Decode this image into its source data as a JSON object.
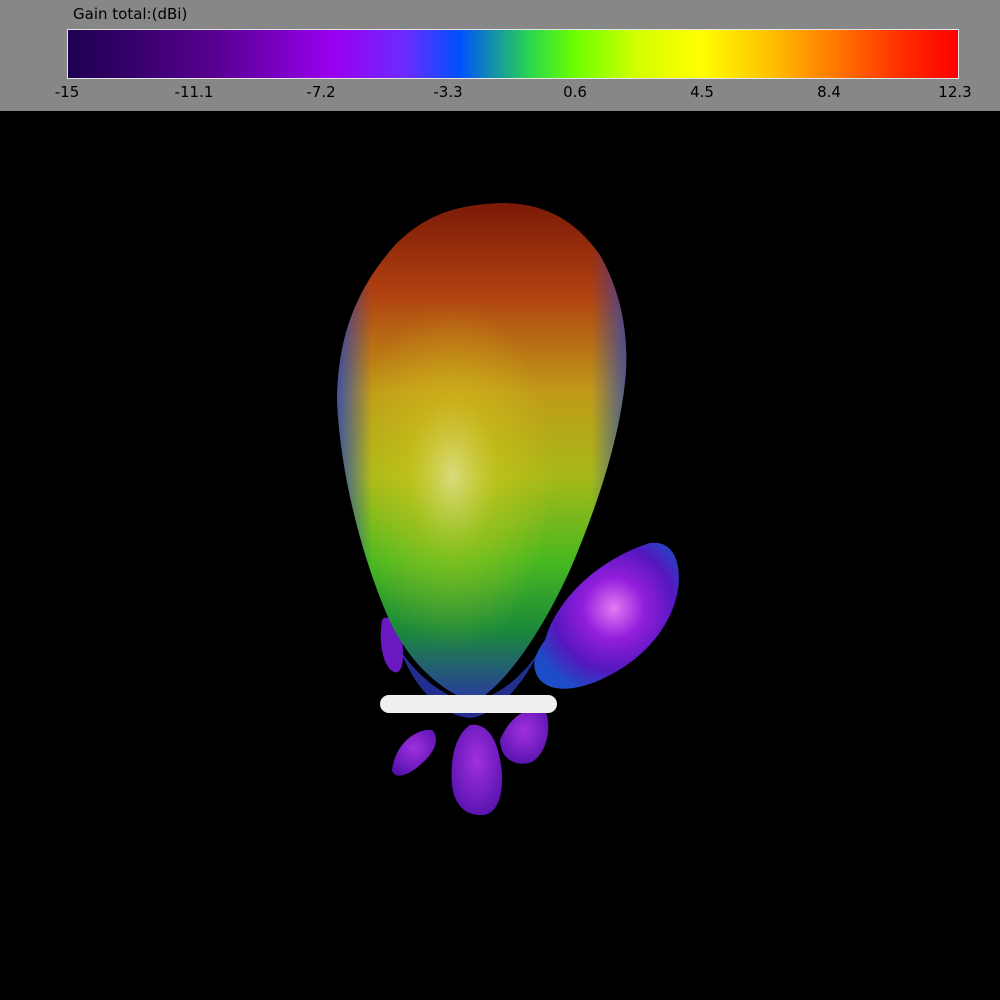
{
  "legend": {
    "title": "Gain total:(dBi)",
    "ticks": [
      "-15",
      "-11.1",
      "-7.2",
      "-3.3",
      "0.6",
      "4.5",
      "8.4",
      "12.3"
    ],
    "min": -15,
    "max": 12.3
  },
  "colors": {
    "panel_bg": "#878787",
    "viewport_bg": "#000000",
    "colormap": [
      "#1e0050",
      "#9a00f0",
      "#0050ff",
      "#6cff00",
      "#ffff00",
      "#ff7a00",
      "#ff0000"
    ]
  },
  "scene": {
    "main_lobe": "gain-main-lobe",
    "side_lobe": "gain-side-lobe",
    "antenna": "antenna-element"
  }
}
